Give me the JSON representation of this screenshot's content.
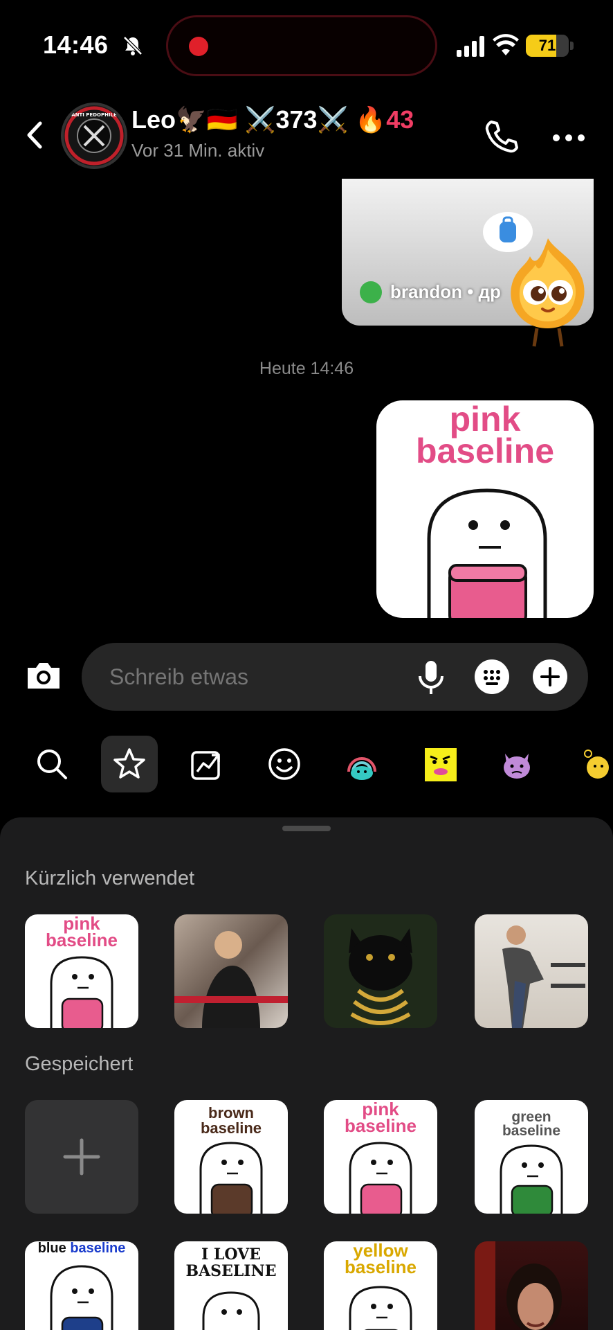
{
  "status_bar": {
    "time": "14:46",
    "battery_level": "71",
    "battery_fraction": 0.71,
    "colors": {
      "battery": "#f5cc18",
      "recording": "#e0202a"
    }
  },
  "header": {
    "contact_name": "Leo🦅🇩🇪 ⚔️373⚔️ 🔥",
    "streak_count": "43",
    "status": "Vor 31 Min. aktiv",
    "avatar_text": "ANTI PEDOPHILE",
    "icons": [
      "chevron-left-icon",
      "phone-icon",
      "more-horizontal-icon"
    ]
  },
  "messages": {
    "shared_card": {
      "username": "brandon • др"
    },
    "date_separator": "Heute 14:46",
    "sticker": {
      "line1": "pink",
      "line2": "baseline"
    }
  },
  "composer": {
    "placeholder": "Schreib etwas",
    "icons": [
      "camera-icon",
      "microphone-icon",
      "keyboard-icon",
      "plus-icon"
    ]
  },
  "tray": {
    "tabs": [
      "search-icon",
      "star-icon",
      "trending-icon",
      "smiley-icon",
      "sticker-pack-1",
      "sticker-pack-2",
      "sticker-pack-3",
      "sticker-pack-4"
    ],
    "active_tab": "star-icon"
  },
  "sheet": {
    "recent_title": "Kürzlich verwendet",
    "saved_title": "Gespeichert",
    "recent": [
      {
        "line1": "pink",
        "line2": "baseline",
        "kind": "sticker"
      },
      {
        "kind": "photo"
      },
      {
        "kind": "photo"
      },
      {
        "kind": "photo"
      }
    ],
    "saved": [
      {
        "kind": "add"
      },
      {
        "line1": "brown",
        "line2": "baseline",
        "jar_color": "#5b3a2a"
      },
      {
        "line1": "pink",
        "line2": "baseline",
        "jar_color": "#e85c8e"
      },
      {
        "line1": "green",
        "line2": "baseline",
        "jar_color": "#2f8a3a"
      },
      {
        "line1": "blue",
        "line2": "baseline",
        "jar_color": "#1e3f8a"
      },
      {
        "line1": "I LOVE",
        "line2": "BASELINE"
      },
      {
        "line1": "yellow",
        "line2": "baseline",
        "jar_color": "#f2c21c"
      },
      {
        "kind": "photo"
      }
    ],
    "colors": {
      "pink_text": "#e24c86",
      "brown_text": "#4a2a1a",
      "green_text": "#555",
      "blue_text": "#1a3ccc",
      "yellow_text": "#d9a800"
    }
  }
}
